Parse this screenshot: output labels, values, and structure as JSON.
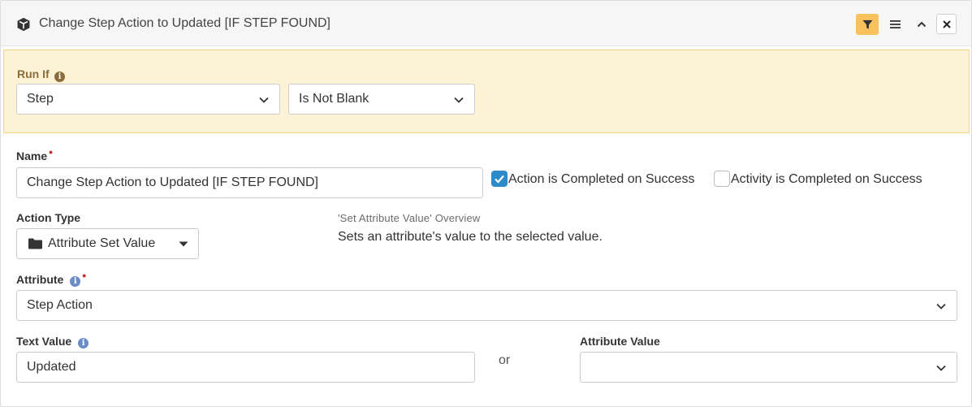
{
  "header": {
    "title": "Change Step Action to Updated [IF STEP FOUND]",
    "icon": "cube-icon",
    "filter_active_color": "#f8c15b"
  },
  "run_if": {
    "label": "Run If",
    "field_value": "Step",
    "operator_value": "Is Not Blank"
  },
  "name": {
    "label": "Name",
    "value": "Change Step Action to Updated [IF STEP FOUND]",
    "required": true
  },
  "action_completed": {
    "label": "Action is Completed on Success",
    "checked": true
  },
  "activity_completed": {
    "label": "Activity is Completed on Success",
    "checked": false
  },
  "action_type": {
    "label": "Action Type",
    "value": "Attribute Set Value"
  },
  "overview": {
    "title": "'Set Attribute Value' Overview",
    "text": "Sets an attribute's value to the selected value."
  },
  "attribute": {
    "label": "Attribute",
    "value": "Step Action",
    "required": true
  },
  "text_value": {
    "label": "Text Value",
    "value": "Updated"
  },
  "or_label": "or",
  "attribute_value": {
    "label": "Attribute Value",
    "value": ""
  }
}
